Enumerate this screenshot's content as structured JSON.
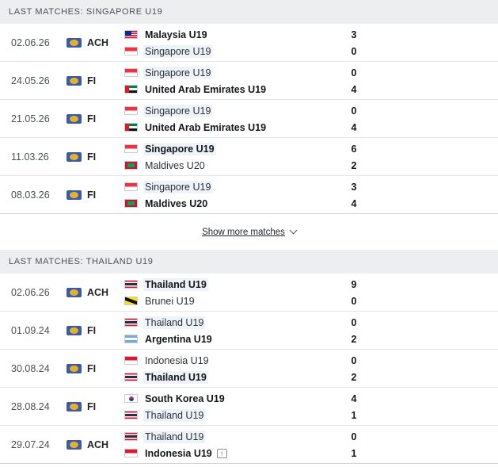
{
  "sections": [
    {
      "title": "LAST MATCHES: SINGAPORE U19",
      "matches": [
        {
          "date": "02.06.26",
          "comp": "ACH",
          "home": {
            "name": "Malaysia U19",
            "flag": "malaysia",
            "score": "3",
            "win": true
          },
          "away": {
            "name": "Singapore U19",
            "flag": "singapore",
            "score": "0",
            "win": false
          }
        },
        {
          "date": "24.05.26",
          "comp": "FI",
          "home": {
            "name": "Singapore U19",
            "flag": "singapore",
            "score": "0",
            "win": false
          },
          "away": {
            "name": "United Arab Emirates U19",
            "flag": "uae",
            "score": "4",
            "win": true
          }
        },
        {
          "date": "21.05.26",
          "comp": "FI",
          "home": {
            "name": "Singapore U19",
            "flag": "singapore",
            "score": "0",
            "win": false
          },
          "away": {
            "name": "United Arab Emirates U19",
            "flag": "uae",
            "score": "4",
            "win": true
          }
        },
        {
          "date": "11.03.26",
          "comp": "FI",
          "home": {
            "name": "Singapore U19",
            "flag": "singapore",
            "score": "6",
            "win": true
          },
          "away": {
            "name": "Maldives U20",
            "flag": "maldives",
            "score": "2",
            "win": false
          }
        },
        {
          "date": "08.03.26",
          "comp": "FI",
          "home": {
            "name": "Singapore U19",
            "flag": "singapore",
            "score": "3",
            "win": false
          },
          "away": {
            "name": "Maldives U20",
            "flag": "maldives",
            "score": "4",
            "win": true
          }
        }
      ],
      "show_more": "Show more matches"
    },
    {
      "title": "LAST MATCHES: THAILAND U19",
      "matches": [
        {
          "date": "02.06.26",
          "comp": "ACH",
          "home": {
            "name": "Thailand U19",
            "flag": "thailand",
            "score": "9",
            "win": true
          },
          "away": {
            "name": "Brunei U19",
            "flag": "brunei",
            "score": "0",
            "win": false
          }
        },
        {
          "date": "01.09.24",
          "comp": "FI",
          "home": {
            "name": "Thailand U19",
            "flag": "thailand",
            "score": "0",
            "win": false
          },
          "away": {
            "name": "Argentina U19",
            "flag": "argentina",
            "score": "2",
            "win": true
          }
        },
        {
          "date": "30.08.24",
          "comp": "FI",
          "home": {
            "name": "Indonesia U19",
            "flag": "indonesia",
            "score": "0",
            "win": false
          },
          "away": {
            "name": "Thailand U19",
            "flag": "thailand",
            "score": "2",
            "win": true
          }
        },
        {
          "date": "28.08.24",
          "comp": "FI",
          "home": {
            "name": "South Korea U19",
            "flag": "south-korea",
            "score": "4",
            "win": true
          },
          "away": {
            "name": "Thailand U19",
            "flag": "thailand",
            "score": "1",
            "win": false
          }
        },
        {
          "date": "29.07.24",
          "comp": "ACH",
          "home": {
            "name": "Thailand U19",
            "flag": "thailand",
            "score": "0",
            "win": false
          },
          "away": {
            "name": "Indonesia U19",
            "flag": "indonesia",
            "score": "1",
            "win": true,
            "badge": "arrow-up-icon"
          }
        }
      ]
    }
  ]
}
